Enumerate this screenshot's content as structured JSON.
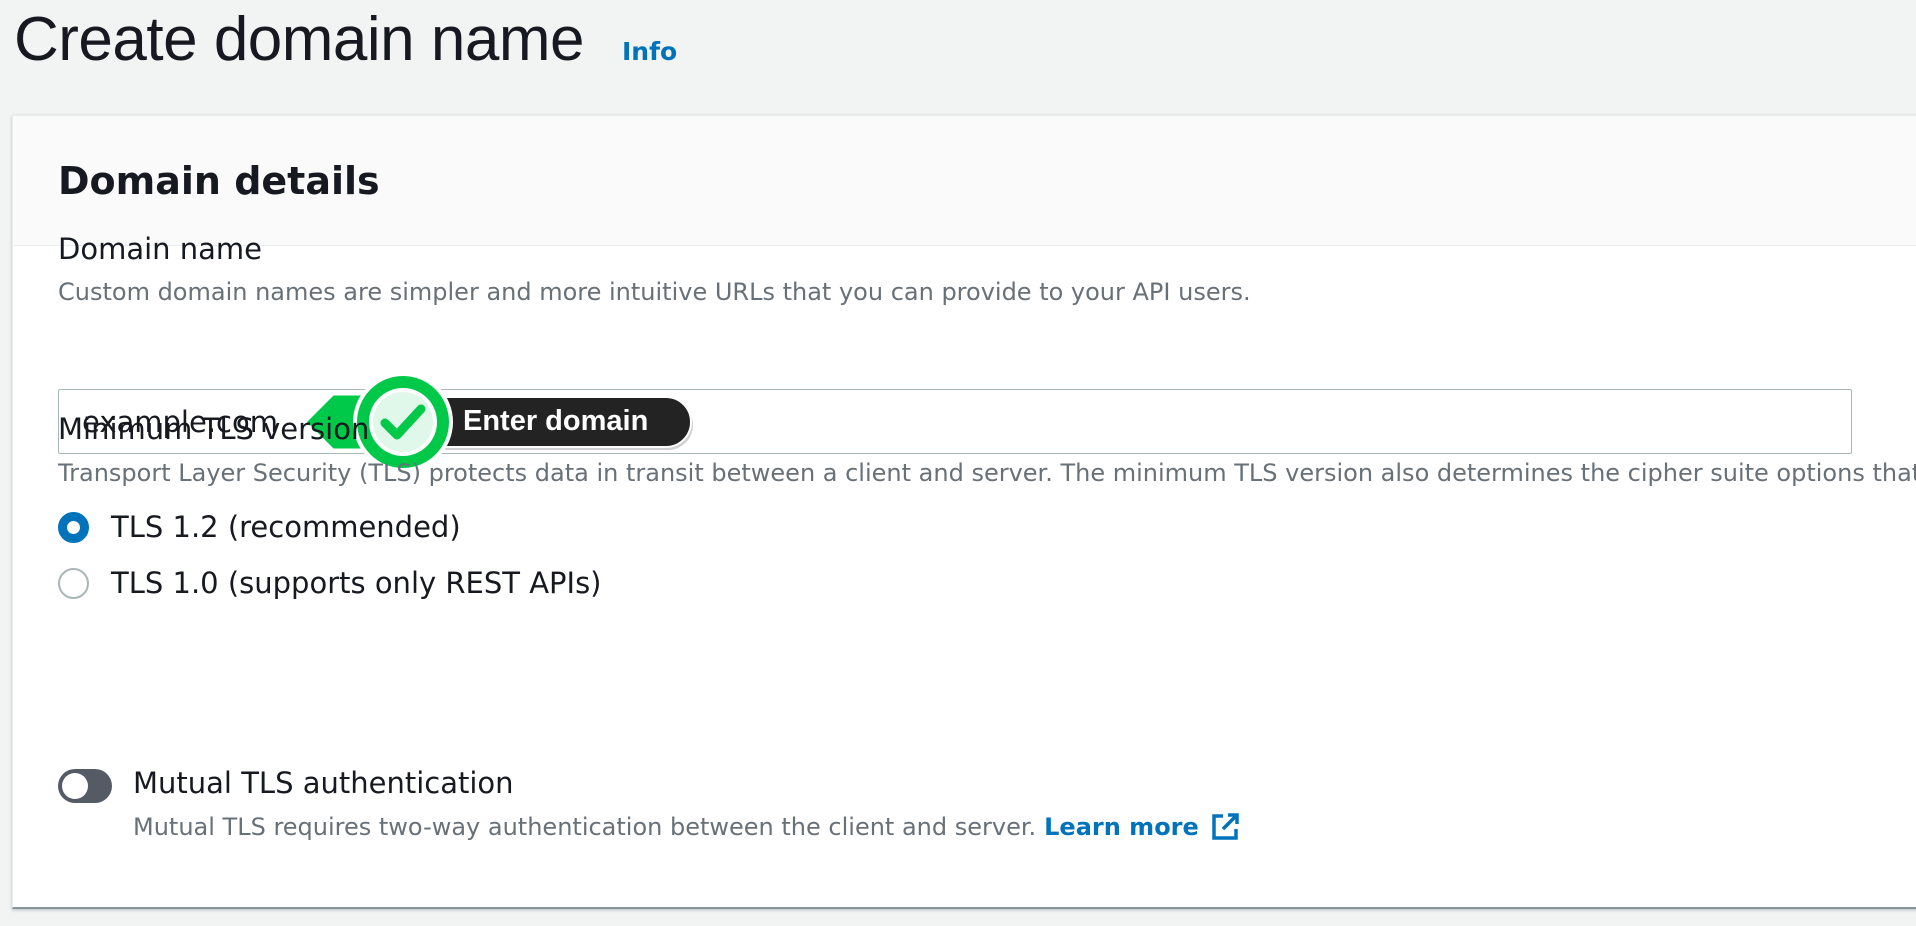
{
  "header": {
    "title": "Create domain name",
    "info_link": "Info"
  },
  "panel": {
    "title": "Domain details"
  },
  "domain_name": {
    "label": "Domain name",
    "description": "Custom domain names are simpler and more intuitive URLs that you can provide to your API users.",
    "value": "example.com",
    "callout_text": "Enter domain",
    "callout_color": "#00c94a"
  },
  "tls": {
    "label": "Minimum TLS version",
    "description": "Transport Layer Security (TLS) protects data in transit between a client and server. The minimum TLS version also determines the cipher suite options that c",
    "options": [
      {
        "label": "TLS 1.2 (recommended)",
        "selected": true
      },
      {
        "label": "TLS 1.0 (supports only REST APIs)",
        "selected": false
      }
    ]
  },
  "mutual_tls": {
    "label": "Mutual TLS authentication",
    "enabled": false,
    "description": "Mutual TLS requires two-way authentication between the client and server.",
    "learn_more": "Learn more",
    "learn_more_icon": "external-link-icon"
  },
  "colors": {
    "link": "#0073bb",
    "selected_radio": "#0073bb",
    "toggle_off": "#545b64"
  }
}
